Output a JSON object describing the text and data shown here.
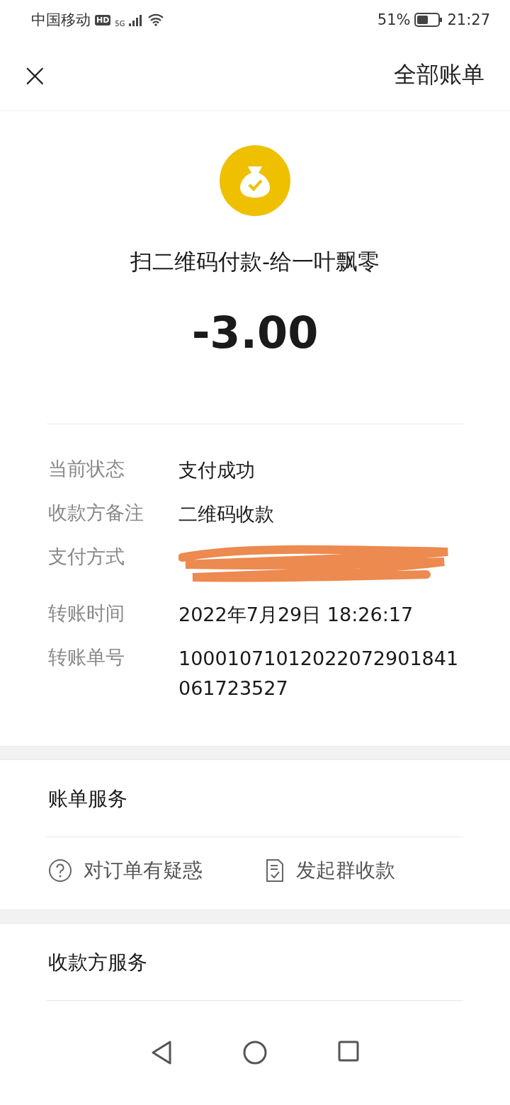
{
  "status_bar": {
    "carrier": "中国移动",
    "hd": "HD",
    "network": "5G",
    "battery_percent": "51%",
    "time": "21:27"
  },
  "header": {
    "close": "×",
    "action": "全部账单"
  },
  "summary": {
    "title": "扫二维码付款-给一叶飘零",
    "amount": "-3.00"
  },
  "details": [
    {
      "label": "当前状态",
      "value": "支付成功",
      "redacted": false
    },
    {
      "label": "收款方备注",
      "value": "二维码收款",
      "redacted": false
    },
    {
      "label": "支付方式",
      "redacted": true
    },
    {
      "label": "转账时间",
      "value": "2022年7月29日 18:26:17",
      "redacted": false
    },
    {
      "label": "转账单号",
      "value": "10001071012022072901841061723527",
      "redacted": false
    }
  ],
  "bill_services": {
    "title": "账单服务",
    "actions": [
      {
        "label": "对订单有疑惑",
        "kind": "question"
      },
      {
        "label": "发起群收款",
        "kind": "document"
      }
    ]
  },
  "payee_services": {
    "title": "收款方服务"
  }
}
